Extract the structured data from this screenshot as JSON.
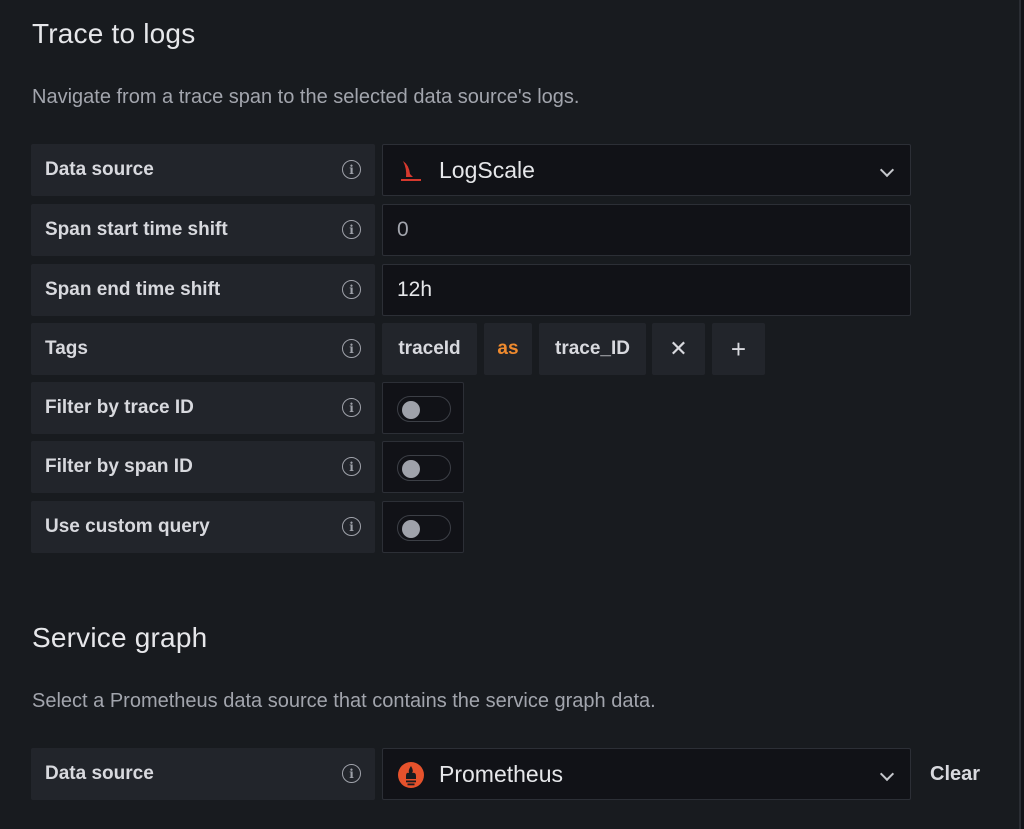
{
  "trace_to_logs": {
    "title": "Trace to logs",
    "description": "Navigate from a trace span to the selected data source's logs.",
    "data_source_label": "Data source",
    "data_source_value": "LogScale",
    "span_start_label": "Span start time shift",
    "span_start_value": "0",
    "span_end_label": "Span end time shift",
    "span_end_value": "12h",
    "tags_label": "Tags",
    "tag_key": "traceId",
    "tag_as": "as",
    "tag_value": "trace_ID",
    "remove_symbol": "✕",
    "add_symbol": "+",
    "filter_trace_label": "Filter by trace ID",
    "filter_span_label": "Filter by span ID",
    "custom_query_label": "Use custom query",
    "filter_trace_enabled": false,
    "filter_span_enabled": false,
    "custom_query_enabled": false
  },
  "service_graph": {
    "title": "Service graph",
    "description": "Select a Prometheus data source that contains the service graph data.",
    "data_source_label": "Data source",
    "data_source_value": "Prometheus",
    "clear_label": "Clear"
  },
  "info_glyph": "i",
  "colors": {
    "accent_orange": "#ef8a2e",
    "logscale_red": "#d6392e",
    "prometheus_orange": "#e6522c",
    "background": "#181b1f"
  }
}
